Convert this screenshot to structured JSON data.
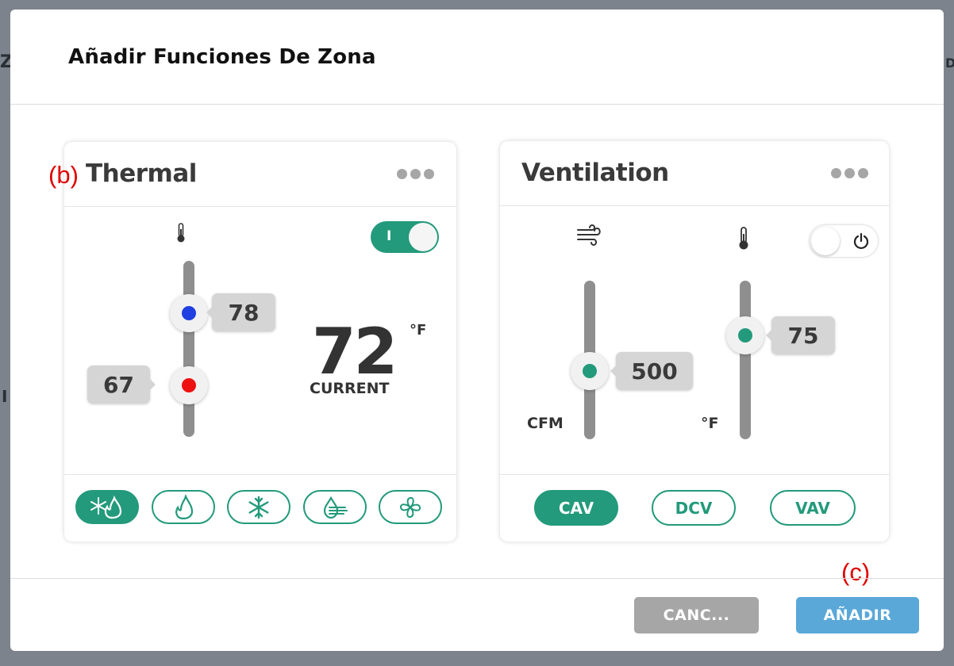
{
  "background": {
    "edge_left_top": "Z",
    "edge_left_mid": "I",
    "edge_right_top": "D"
  },
  "dialog": {
    "title": "Añadir Funciones De Zona",
    "cancel_label": "CANC...",
    "add_label": "AÑADIR"
  },
  "annotations": {
    "b": "(b)",
    "c": "(c)"
  },
  "thermal": {
    "title": "Thermal",
    "toggle_label": "I",
    "cool_setpoint": "78",
    "heat_setpoint": "67",
    "current_temp": "72",
    "current_label": "CURRENT",
    "unit": "°F",
    "modes": [
      {
        "name": "auto",
        "icon": "snowflake-flame-icon",
        "active": true
      },
      {
        "name": "heat",
        "icon": "flame-icon",
        "active": false
      },
      {
        "name": "cool",
        "icon": "snowflake-icon",
        "active": false
      },
      {
        "name": "dry",
        "icon": "water-drop-wind-icon",
        "active": false
      },
      {
        "name": "fan",
        "icon": "fan-icon",
        "active": false
      }
    ]
  },
  "ventilation": {
    "title": "Ventilation",
    "airflow_value": "500",
    "airflow_unit": "CFM",
    "temp_value": "75",
    "temp_unit": "°F",
    "types": [
      {
        "label": "CAV",
        "active": true
      },
      {
        "label": "DCV",
        "active": false
      },
      {
        "label": "VAV",
        "active": false
      }
    ]
  },
  "colors": {
    "accent_green": "#239a7b",
    "cool_blue": "#1f3fe0",
    "heat_red": "#ee1111",
    "add_button": "#5aa8d8",
    "cancel_button": "#a6a6a6",
    "annotation_red": "#e00000"
  }
}
